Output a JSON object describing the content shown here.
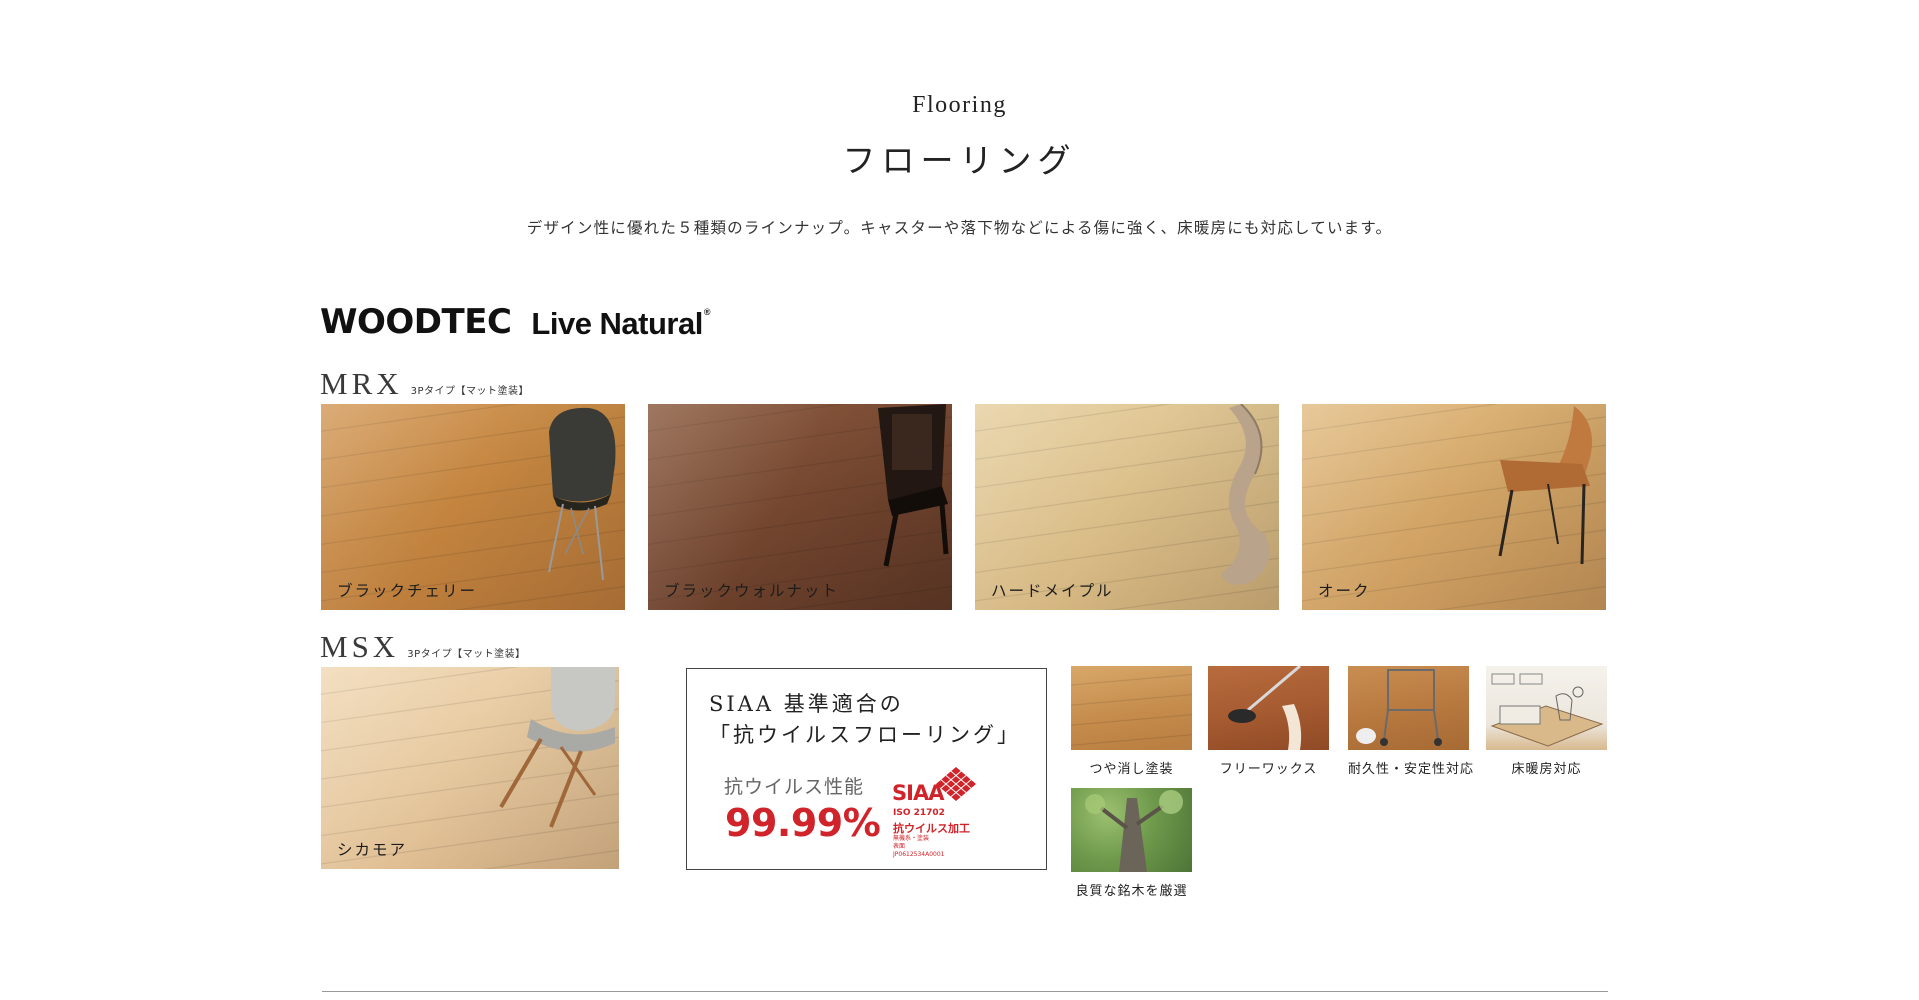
{
  "header": {
    "eyebrow": "Flooring",
    "title": "フローリング",
    "lead": "デザイン性に優れた５種類のラインナップ。キャスターや落下物などによる傷に強く、床暖房にも対応しています。"
  },
  "brand": {
    "logo_text": "WOODTEC",
    "sub_name": "Live Natural",
    "registered": "®"
  },
  "series": [
    {
      "name": "MRX",
      "type": "3Pタイプ【マット塗装】",
      "swatches": [
        {
          "label": "ブラックチェリー"
        },
        {
          "label": "ブラックウォルナット"
        },
        {
          "label": "ハードメイプル"
        },
        {
          "label": "オーク"
        }
      ]
    },
    {
      "name": "MSX",
      "type": "3Pタイプ【マット塗装】",
      "swatches": [
        {
          "label": "シカモア"
        }
      ]
    }
  ],
  "siaa": {
    "heading_line1": "SIAA 基準適合の",
    "heading_line2": "「抗ウイルスフローリング」",
    "performance_label": "抗ウイルス性能",
    "performance_value": "99.99%",
    "mark_logo": "SIAA",
    "mark_iso": "ISO 21702",
    "mark_anti": "抗ウイルス加工",
    "mark_small1": "無機系・塗装",
    "mark_small2": "表面",
    "mark_small3": "JP0612534A0001"
  },
  "features": [
    {
      "caption": "つや消し塗装",
      "icon": "matte-finish-photo"
    },
    {
      "caption": "フリーワックス",
      "icon": "wax-free-photo"
    },
    {
      "caption": "耐久性・安定性対応",
      "icon": "durability-photo"
    },
    {
      "caption": "床暖房対応",
      "icon": "floor-heating-illustration"
    },
    {
      "caption": "良質な銘木を厳選",
      "icon": "tree-photo"
    }
  ],
  "colors": {
    "accent_red": "#d0232a",
    "text": "#222222"
  }
}
